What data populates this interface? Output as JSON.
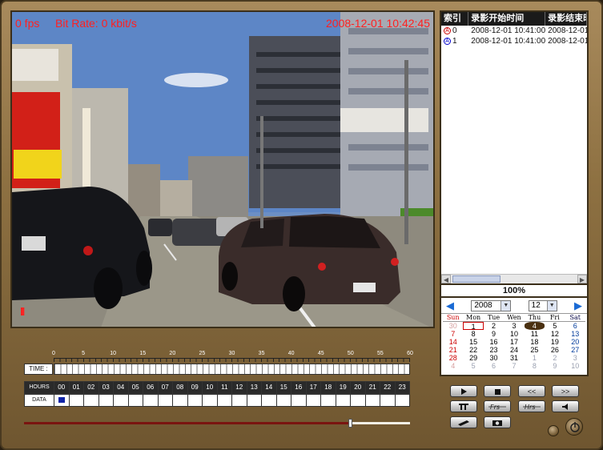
{
  "video": {
    "fps": "0 fps",
    "bitrate": "Bit Rate: 0 kbit/s",
    "timestamp": "2008-12-01 10:42:45",
    "rec_indicator": "II"
  },
  "list": {
    "columns": [
      "索引",
      "录影开始时间",
      "录影结束时"
    ],
    "rows": [
      {
        "icon": "A",
        "index": "0",
        "start": "2008-12-01 10:41:00",
        "end": "2008-12-01"
      },
      {
        "icon": "A",
        "index": "1",
        "start": "2008-12-01 10:41:00",
        "end": "2008-12-01"
      }
    ]
  },
  "zoom": "100%",
  "calendar": {
    "year": "2008",
    "month": "12",
    "weekdays": [
      "Sun",
      "Mon",
      "Tue",
      "Wen",
      "Thu",
      "Fri",
      "Sat"
    ],
    "weeks": [
      [
        "30",
        "1",
        "2",
        "3",
        "4",
        "5",
        "6"
      ],
      [
        "7",
        "8",
        "9",
        "10",
        "11",
        "12",
        "13"
      ],
      [
        "14",
        "15",
        "16",
        "17",
        "18",
        "19",
        "20"
      ],
      [
        "21",
        "22",
        "23",
        "24",
        "25",
        "26",
        "27"
      ],
      [
        "28",
        "29",
        "30",
        "31",
        "1",
        "2",
        "3"
      ],
      [
        "4",
        "5",
        "6",
        "7",
        "8",
        "9",
        "10"
      ]
    ],
    "today": "1",
    "selected": "4"
  },
  "timeline": {
    "ruler_labels": [
      "0",
      "5",
      "10",
      "15",
      "20",
      "25",
      "30",
      "35",
      "40",
      "45",
      "50",
      "55",
      "60"
    ],
    "time_label": "TIME :",
    "hours_label": "HOURS",
    "data_label": "DATA",
    "hours": [
      "00",
      "01",
      "02",
      "03",
      "04",
      "05",
      "06",
      "07",
      "08",
      "09",
      "10",
      "11",
      "12",
      "13",
      "14",
      "15",
      "16",
      "17",
      "18",
      "19",
      "20",
      "21",
      "22",
      "23"
    ],
    "data_marked_hour": 0,
    "playback_position": 0.84
  },
  "controls": {
    "rewind_label": "<<",
    "forward_label": ">>"
  },
  "colors": {
    "overlay_red": "#ff2020",
    "frame_gold": "#8e7142",
    "calendar_arrow": "#1a6ad4",
    "data_mark": "#1025a8"
  }
}
